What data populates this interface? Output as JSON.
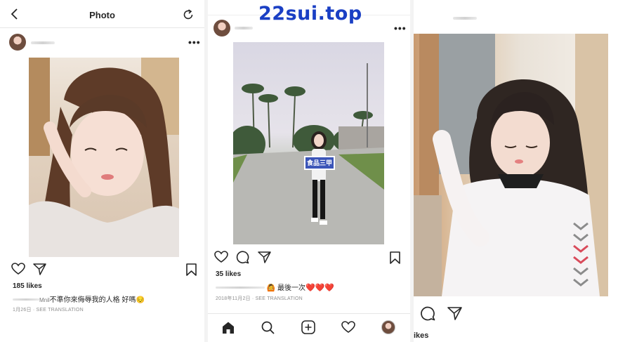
{
  "watermark": {
    "text": "22sui.top",
    "color": "#1a3fc4"
  },
  "panel1": {
    "header_title": "Photo",
    "back_icon": "chevron-left-icon",
    "refresh_icon": "refresh-icon",
    "more_label": "•••",
    "likes": "185 likes",
    "caption": "不準你來侮辱我的人格 好嗎😔",
    "caption_user_stub": "Mnil",
    "date": "1月26日",
    "translate": "SEE TRANSLATION"
  },
  "panel2": {
    "more_label": "•••",
    "likes": "35 likes",
    "caption_emoji": "🙆",
    "caption": "最後一次",
    "hearts": "❤️❤️❤️",
    "date": "2018年11月2日",
    "translate": "SEE TRANSLATION",
    "sign_text": "食品三甲",
    "tab_icons": [
      "home-icon",
      "search-icon",
      "add-post-icon",
      "heart-icon",
      "profile-avatar"
    ]
  },
  "panel3": {
    "likes_partial": "ikes"
  },
  "colors": {
    "text": "#262626",
    "meta": "#8e8e8e",
    "border": "#e6e6e6",
    "heart": "#d8262b"
  }
}
